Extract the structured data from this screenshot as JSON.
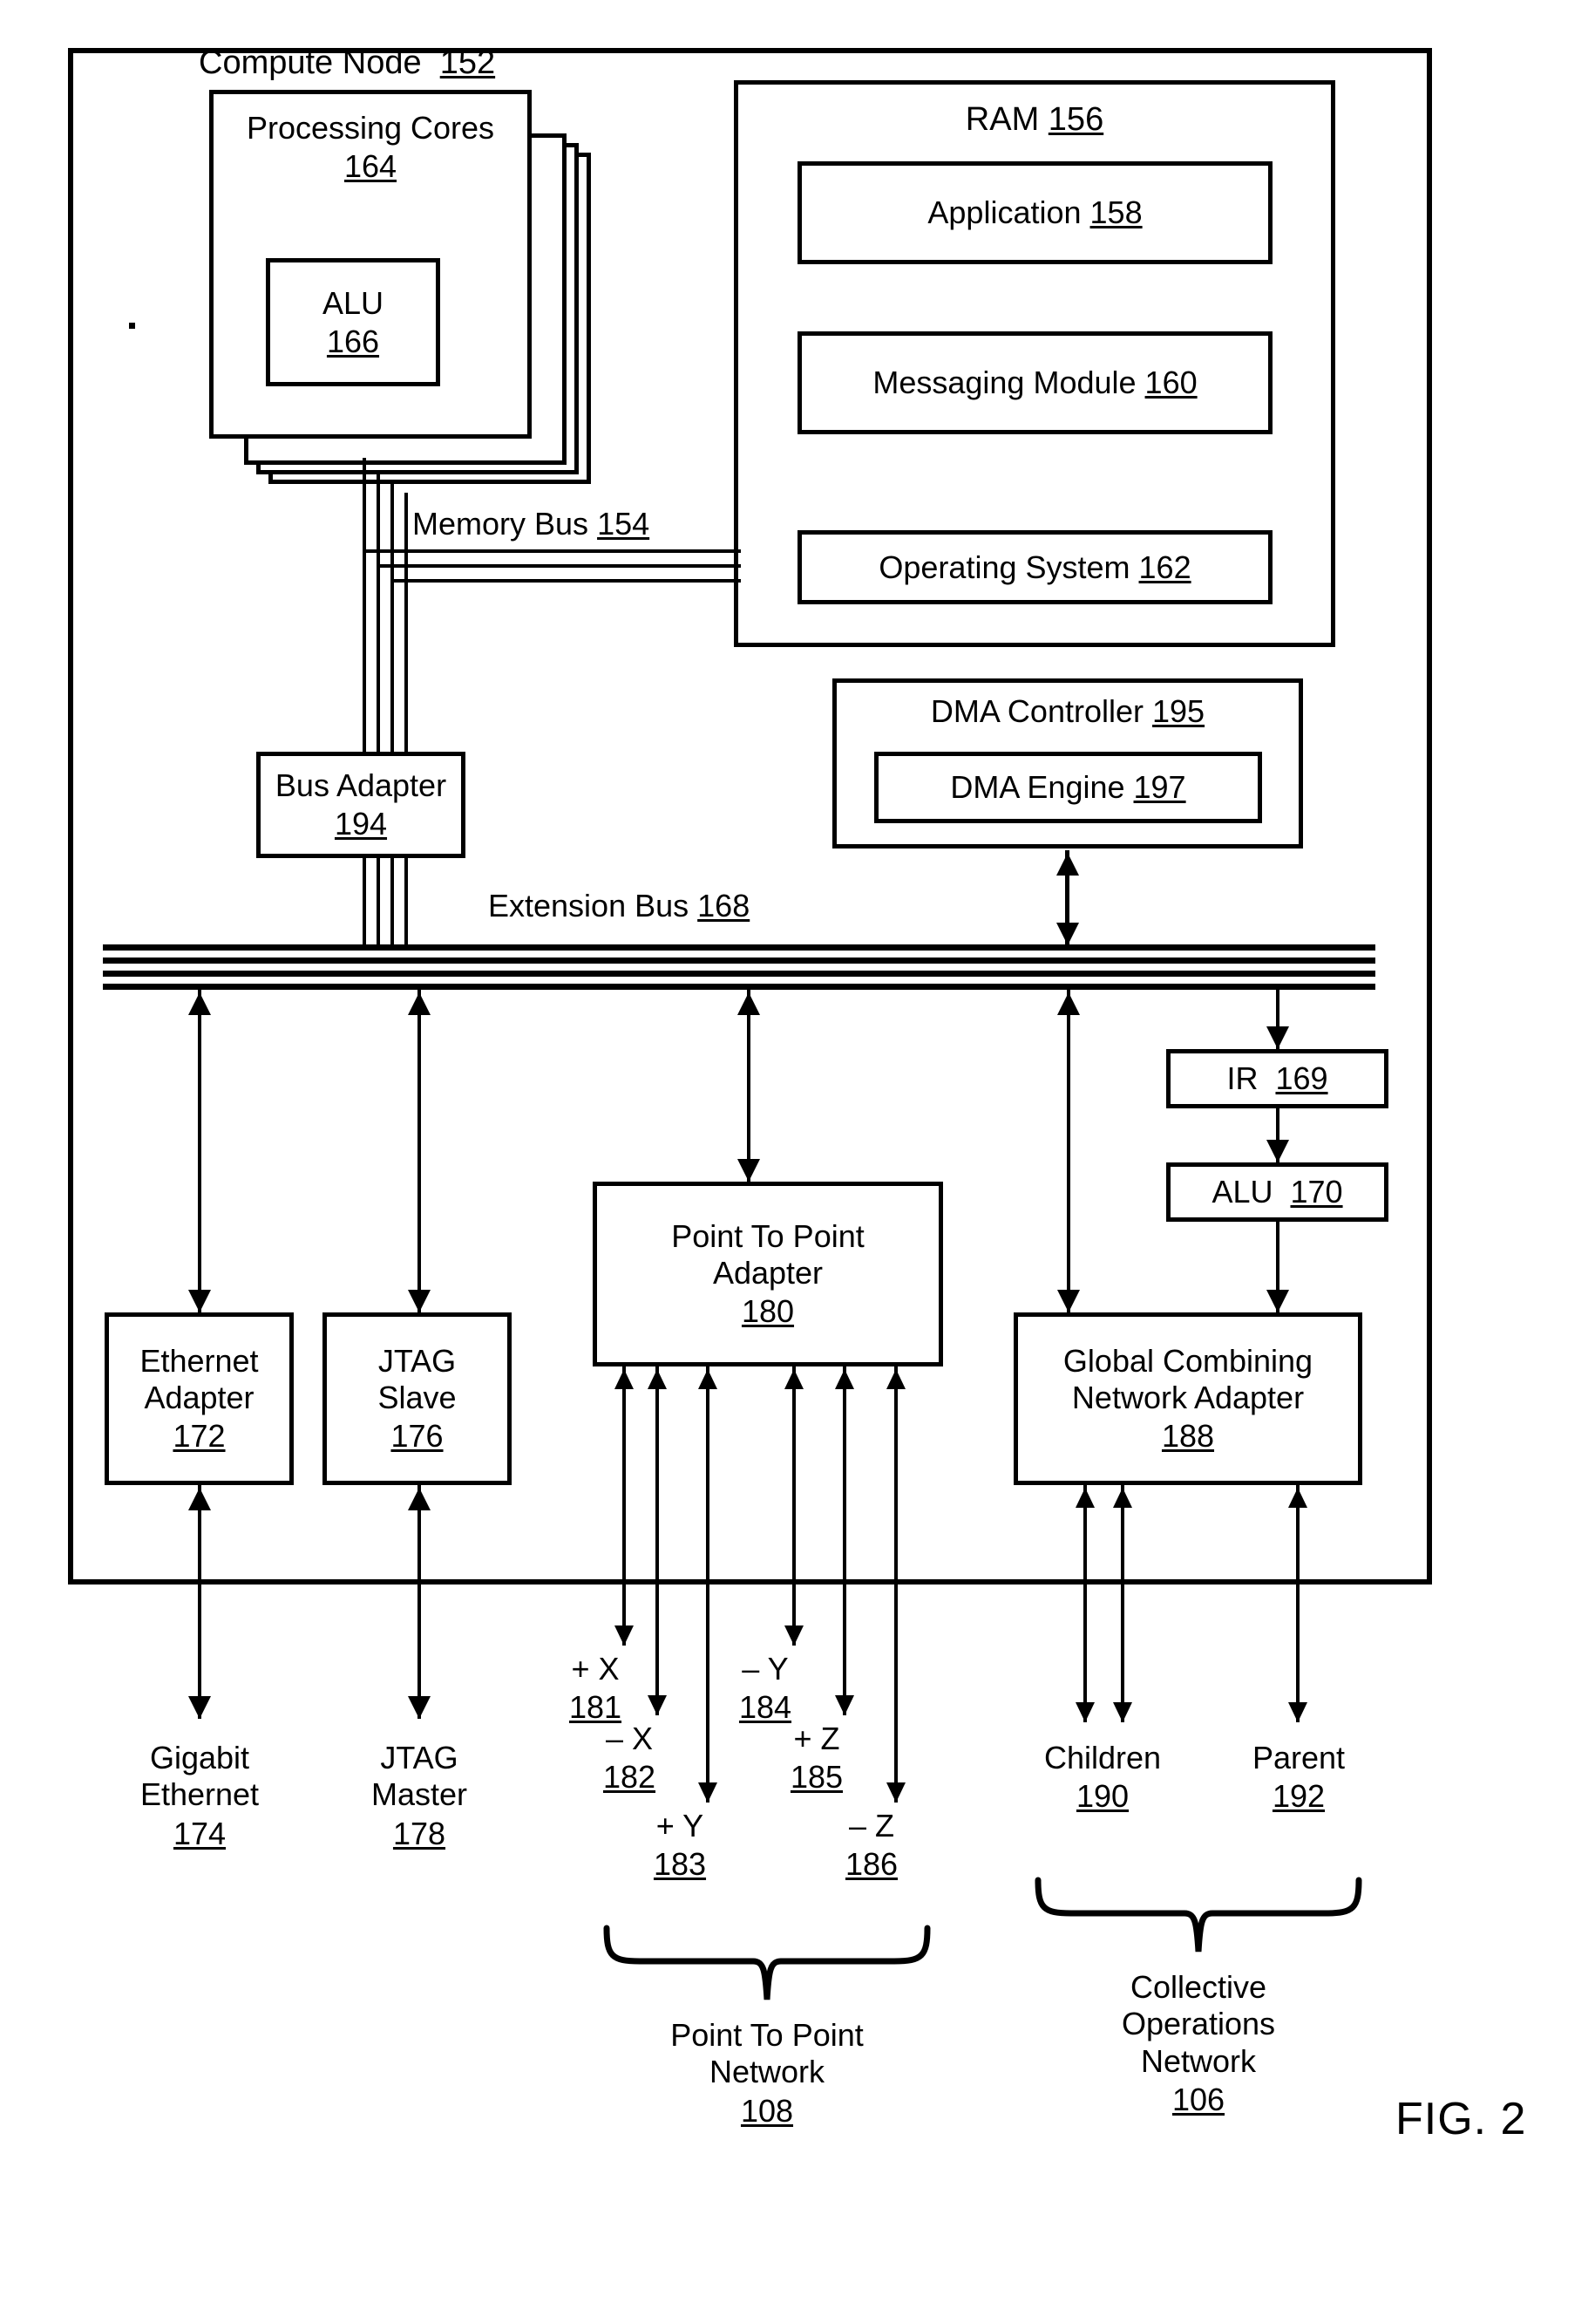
{
  "figure": {
    "caption": "FIG. 2"
  },
  "compute_node": {
    "title": "Compute Node",
    "ref": "152"
  },
  "processing_cores": {
    "title": "Processing Cores",
    "ref": "164",
    "alu": {
      "title": "ALU",
      "ref": "166"
    }
  },
  "ram": {
    "title": "RAM",
    "ref": "156",
    "items": [
      {
        "label": "Application",
        "ref": "158"
      },
      {
        "label": "Messaging Module",
        "ref": "160"
      },
      {
        "label": "Operating System",
        "ref": "162"
      }
    ]
  },
  "memory_bus": {
    "label": "Memory Bus",
    "ref": "154"
  },
  "bus_adapter": {
    "label": "Bus Adapter",
    "ref": "194"
  },
  "extension_bus": {
    "label": "Extension Bus",
    "ref": "168"
  },
  "dma": {
    "controller": {
      "label": "DMA Controller",
      "ref": "195"
    },
    "engine": {
      "label": "DMA Engine",
      "ref": "197"
    }
  },
  "ir": {
    "label": "IR",
    "ref": "169"
  },
  "alu_170": {
    "label": "ALU",
    "ref": "170"
  },
  "adapters": {
    "ethernet": {
      "line1": "Ethernet",
      "line2": "Adapter",
      "ref": "172"
    },
    "jtag_slave": {
      "line1": "JTAG",
      "line2": "Slave",
      "ref": "176"
    },
    "point_to_point": {
      "line1": "Point To Point",
      "line2": "Adapter",
      "ref": "180"
    },
    "global_combining": {
      "line1": "Global Combining",
      "line2": "Network Adapter",
      "ref": "188"
    }
  },
  "endpoints": {
    "gigabit_ethernet": {
      "line1": "Gigabit",
      "line2": "Ethernet",
      "ref": "174"
    },
    "jtag_master": {
      "line1": "JTAG",
      "line2": "Master",
      "ref": "178"
    },
    "children": {
      "label": "Children",
      "ref": "190"
    },
    "parent": {
      "label": "Parent",
      "ref": "192"
    }
  },
  "axes": [
    {
      "label": "+ X",
      "ref": "181"
    },
    {
      "label": "– X",
      "ref": "182"
    },
    {
      "label": "+ Y",
      "ref": "183"
    },
    {
      "label": "– Y",
      "ref": "184"
    },
    {
      "label": "+ Z",
      "ref": "185"
    },
    {
      "label": "– Z",
      "ref": "186"
    }
  ],
  "networks": {
    "point_to_point": {
      "line1": "Point To Point",
      "line2": "Network",
      "ref": "108"
    },
    "collective": {
      "line1": "Collective",
      "line2": "Operations",
      "line3": "Network",
      "ref": "106"
    }
  }
}
